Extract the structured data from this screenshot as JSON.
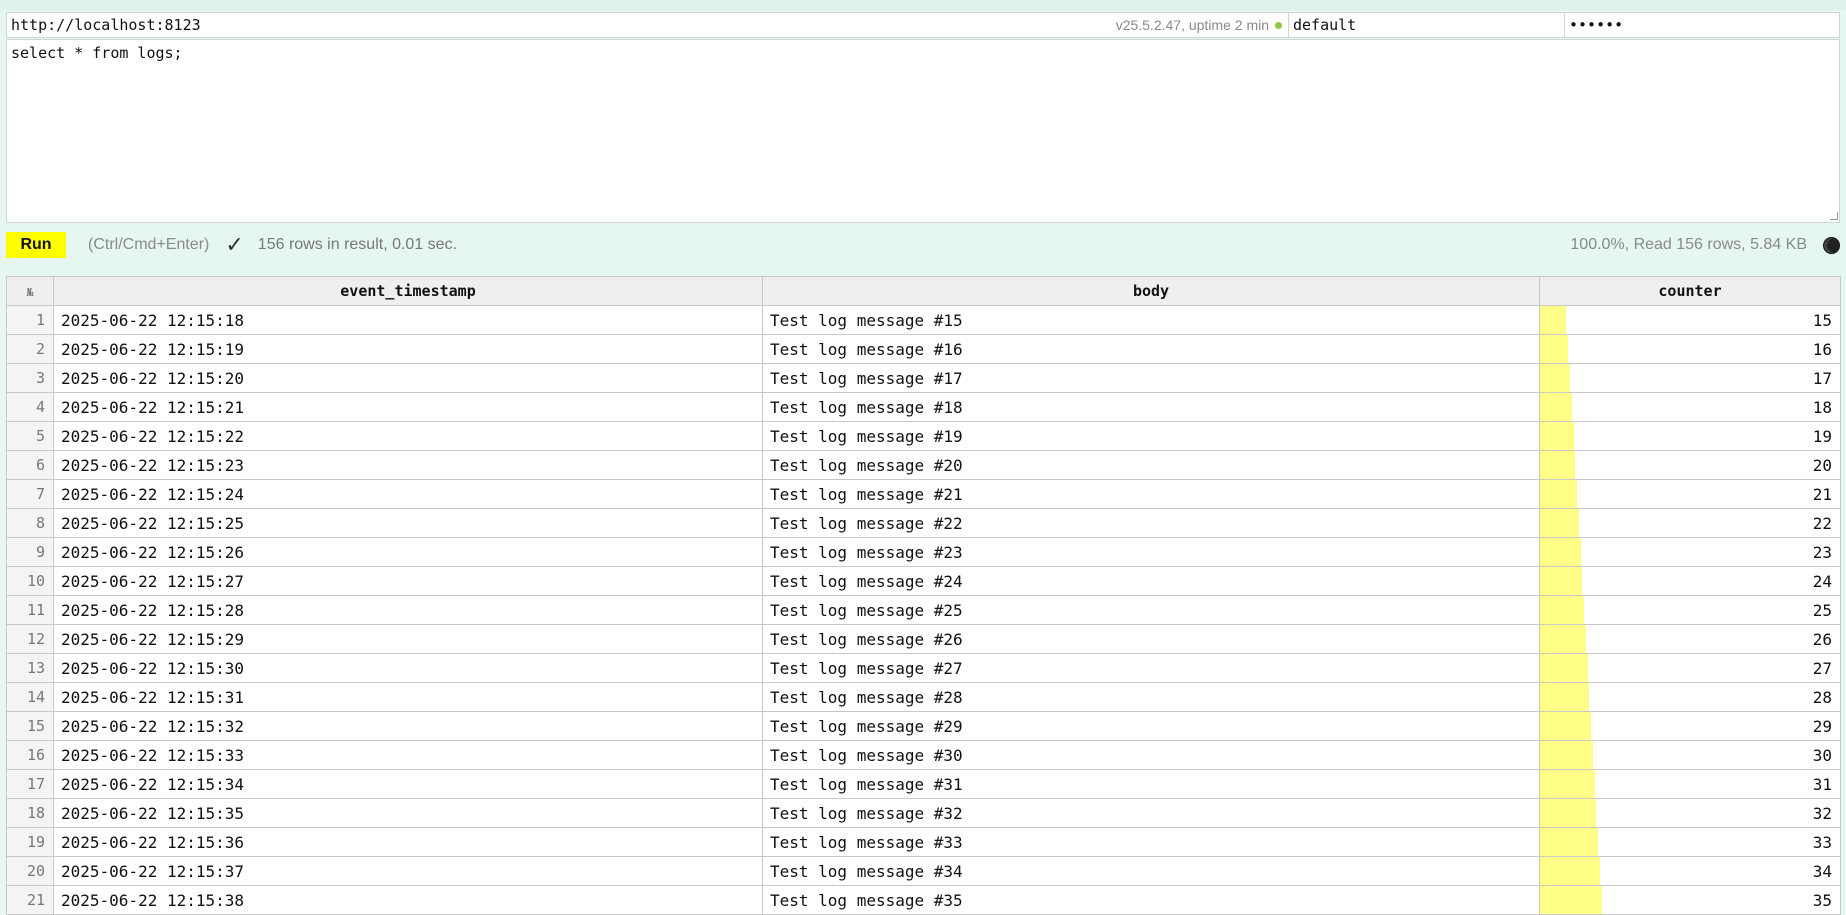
{
  "connection": {
    "url": "http://localhost:8123",
    "server_info": "v25.5.2.47, uptime 2 min",
    "user": "default",
    "password": "••••••"
  },
  "query": "select * from logs;",
  "toolbar": {
    "run_label": "Run",
    "shortcut_hint": "(Ctrl/Cmd+Enter)",
    "check_icon": "✓",
    "result_summary": "156 rows in result, 0.01 sec.",
    "read_stats": "100.0%, Read 156 rows, 5.84 KB"
  },
  "colors": {
    "accent_yellow": "#ffff00",
    "bar_yellow": "#ffff88",
    "status_green": "#8dc63f",
    "background": "#e6f7f2"
  },
  "table": {
    "corner_icon": "№",
    "columns": [
      "event_timestamp",
      "body",
      "counter"
    ],
    "counter_max": 170,
    "rows": [
      {
        "n": "1",
        "event_timestamp": "2025-06-22 12:15:18",
        "body": "Test log message #15",
        "counter": "15"
      },
      {
        "n": "2",
        "event_timestamp": "2025-06-22 12:15:19",
        "body": "Test log message #16",
        "counter": "16"
      },
      {
        "n": "3",
        "event_timestamp": "2025-06-22 12:15:20",
        "body": "Test log message #17",
        "counter": "17"
      },
      {
        "n": "4",
        "event_timestamp": "2025-06-22 12:15:21",
        "body": "Test log message #18",
        "counter": "18"
      },
      {
        "n": "5",
        "event_timestamp": "2025-06-22 12:15:22",
        "body": "Test log message #19",
        "counter": "19"
      },
      {
        "n": "6",
        "event_timestamp": "2025-06-22 12:15:23",
        "body": "Test log message #20",
        "counter": "20"
      },
      {
        "n": "7",
        "event_timestamp": "2025-06-22 12:15:24",
        "body": "Test log message #21",
        "counter": "21"
      },
      {
        "n": "8",
        "event_timestamp": "2025-06-22 12:15:25",
        "body": "Test log message #22",
        "counter": "22"
      },
      {
        "n": "9",
        "event_timestamp": "2025-06-22 12:15:26",
        "body": "Test log message #23",
        "counter": "23"
      },
      {
        "n": "10",
        "event_timestamp": "2025-06-22 12:15:27",
        "body": "Test log message #24",
        "counter": "24"
      },
      {
        "n": "11",
        "event_timestamp": "2025-06-22 12:15:28",
        "body": "Test log message #25",
        "counter": "25"
      },
      {
        "n": "12",
        "event_timestamp": "2025-06-22 12:15:29",
        "body": "Test log message #26",
        "counter": "26"
      },
      {
        "n": "13",
        "event_timestamp": "2025-06-22 12:15:30",
        "body": "Test log message #27",
        "counter": "27"
      },
      {
        "n": "14",
        "event_timestamp": "2025-06-22 12:15:31",
        "body": "Test log message #28",
        "counter": "28"
      },
      {
        "n": "15",
        "event_timestamp": "2025-06-22 12:15:32",
        "body": "Test log message #29",
        "counter": "29"
      },
      {
        "n": "16",
        "event_timestamp": "2025-06-22 12:15:33",
        "body": "Test log message #30",
        "counter": "30"
      },
      {
        "n": "17",
        "event_timestamp": "2025-06-22 12:15:34",
        "body": "Test log message #31",
        "counter": "31"
      },
      {
        "n": "18",
        "event_timestamp": "2025-06-22 12:15:35",
        "body": "Test log message #32",
        "counter": "32"
      },
      {
        "n": "19",
        "event_timestamp": "2025-06-22 12:15:36",
        "body": "Test log message #33",
        "counter": "33"
      },
      {
        "n": "20",
        "event_timestamp": "2025-06-22 12:15:37",
        "body": "Test log message #34",
        "counter": "34"
      },
      {
        "n": "21",
        "event_timestamp": "2025-06-22 12:15:38",
        "body": "Test log message #35",
        "counter": "35"
      }
    ]
  }
}
